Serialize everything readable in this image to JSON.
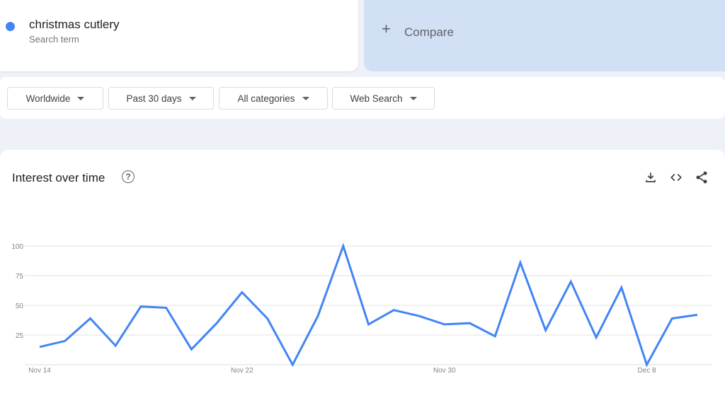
{
  "search_term": {
    "name": "christmas cutlery",
    "type": "Search term",
    "color": "#4285f4"
  },
  "compare": {
    "icon": "plus-icon",
    "label": "Compare"
  },
  "filters": [
    {
      "label": "Worldwide"
    },
    {
      "label": "Past 30 days"
    },
    {
      "label": "All categories"
    },
    {
      "label": "Web Search"
    }
  ],
  "interest_panel": {
    "title": "Interest over time",
    "icons": [
      "help-icon",
      "download-icon",
      "embed-code-icon",
      "share-icon"
    ]
  },
  "chart_data": {
    "type": "line",
    "title": "Interest over time",
    "x": [
      "Nov 14",
      "Nov 15",
      "Nov 16",
      "Nov 17",
      "Nov 18",
      "Nov 19",
      "Nov 20",
      "Nov 21",
      "Nov 22",
      "Nov 23",
      "Nov 24",
      "Nov 25",
      "Nov 26",
      "Nov 27",
      "Nov 28",
      "Nov 29",
      "Nov 30",
      "Dec 1",
      "Dec 2",
      "Dec 3",
      "Dec 4",
      "Dec 5",
      "Dec 6",
      "Dec 7",
      "Dec 8",
      "Dec 9",
      "Dec 10"
    ],
    "x_tick_labels": [
      "Nov 14",
      "Nov 22",
      "Nov 30",
      "Dec 8"
    ],
    "y_tick_labels": [
      "100",
      "75",
      "50",
      "25"
    ],
    "series": [
      {
        "name": "christmas cutlery",
        "color": "#4285f4",
        "values": [
          15,
          20,
          39,
          16,
          49,
          48,
          13,
          35,
          61,
          39,
          0,
          41,
          100,
          34,
          46,
          41,
          34,
          35,
          24,
          86,
          29,
          70,
          23,
          65,
          0,
          39,
          42
        ]
      }
    ],
    "ylim": [
      0,
      100
    ],
    "grid": true
  }
}
